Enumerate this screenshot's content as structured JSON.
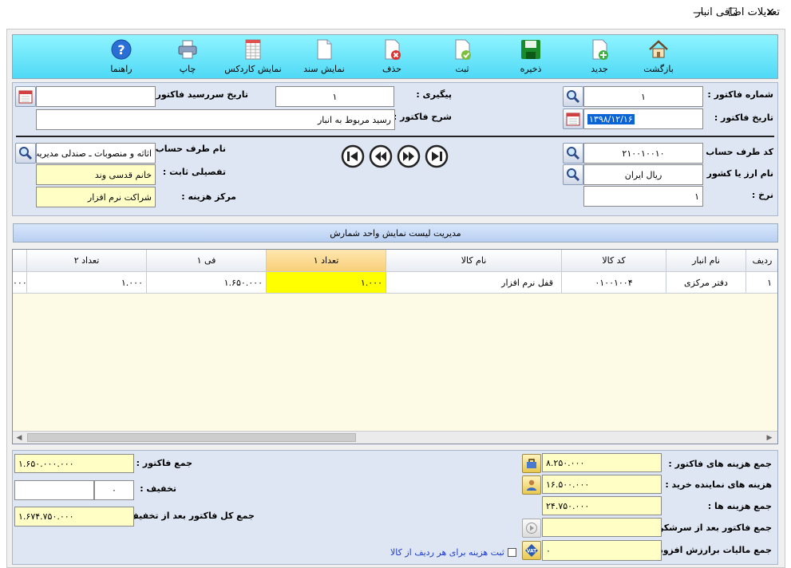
{
  "window": {
    "title": "تعدیلات اضافی انبار",
    "minimize_glyph": "—",
    "maximize_glyph": "☐",
    "close_glyph": "✕"
  },
  "toolbar": {
    "items": [
      {
        "label": "بازگشت",
        "icon": "home-icon"
      },
      {
        "label": "جدید",
        "icon": "new-document-icon"
      },
      {
        "label": "ذخیره",
        "icon": "save-icon"
      },
      {
        "label": "ثبت",
        "icon": "approve-icon"
      },
      {
        "label": "حذف",
        "icon": "delete-icon"
      },
      {
        "label": "نمایش سند",
        "icon": "document-icon"
      },
      {
        "label": "نمایش کاردکس",
        "icon": "cardex-icon"
      },
      {
        "label": "چاپ",
        "icon": "print-icon"
      },
      {
        "label": "راهنما",
        "icon": "help-icon"
      }
    ]
  },
  "header": {
    "invoice_number_label": "شماره فاکتور :",
    "invoice_number": "۱",
    "invoice_date_label": "تاریخ فاکتور :",
    "invoice_date": "۱۳۹۸/۱۲/۱۶",
    "followup_label": "پیگیری :",
    "followup": "۱",
    "description_label": "شرح فاکتور :",
    "description": "رسید مربوط به انبار",
    "due_date_label": "تاریخ سررسید فاکتور :",
    "due_date": ""
  },
  "account": {
    "code_label": "کد طرف حساب :",
    "code": "۲۱۰۰۱۰۰۱۰",
    "name_label": "نام طرف حساب :",
    "name": "اثاثه و منصوبات ـ صندلی مدیریت",
    "currency_label": "نام ارز یا کشور :",
    "currency": "ریال ایران",
    "detail_label": "تفصیلی ثابت :",
    "detail": "خانم قدسی وند",
    "rate_label": "نرخ :",
    "rate": "۱",
    "cost_center_label": "مرکز هزینه :",
    "cost_center": "شراکت نرم افزار"
  },
  "list": {
    "title": "مدیریت لیست نمایش واحد شمارش",
    "columns": [
      "ردیف",
      "نام انبار",
      "کد کالا",
      "نام کالا",
      "تعداد ۱",
      "فی ۱",
      "تعداد ۲"
    ],
    "rows": [
      {
        "row": "۱",
        "warehouse": "دفتر مرکزی",
        "code": "۰۱۰۰۱۰۰۴",
        "name": "قفل نرم افزار",
        "qty1": "۱.۰۰۰",
        "price1": "۱.۶۵۰.۰۰۰",
        "qty2": "۱.۰۰۰",
        "extra": "۰۰۰"
      }
    ]
  },
  "totals": {
    "invoice_total_label": "جمع فاکتور :",
    "invoice_total": "۱.۶۵۰.۰۰۰.۰۰۰",
    "discount_label": "تخفیف :",
    "discount_percent": "۰",
    "discount_amount": "",
    "grand_total_label": "جمع کل فاکتور بعد از تخفیف :",
    "grand_total": "۱.۶۷۴.۷۵۰.۰۰۰",
    "invoice_costs_label": "جمع هزینه های فاکتور :",
    "invoice_costs": "۸.۲۵۰.۰۰۰",
    "rep_costs_label": "هزینه های نماینده خرید :",
    "rep_costs": "۱۶.۵۰۰.۰۰۰",
    "costs_sum_label": "جمع هزینه ها :",
    "costs_sum": "۲۴.۷۵۰.۰۰۰",
    "after_share_label": "جمع فاکتور بعد از سرشکن :",
    "after_share": "",
    "vat_label": "جمع مالیات برارزش افزوده :",
    "vat": "۰",
    "per_row_cost_label": "ثبت هزینه برای هر ردیف از کالا"
  }
}
